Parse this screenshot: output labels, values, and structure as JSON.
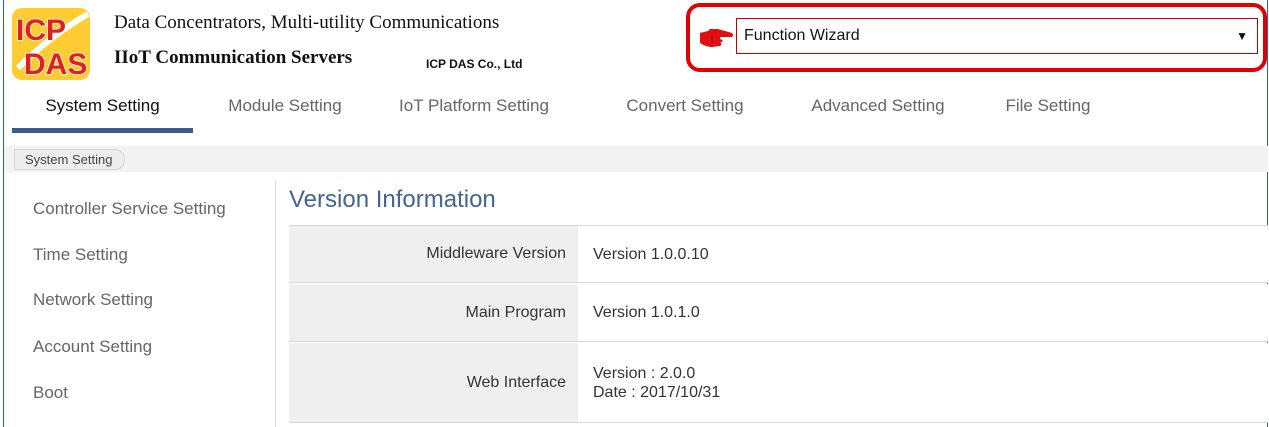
{
  "header": {
    "logo_text": "ICP DAS",
    "line1": "Data Concentrators, Multi-utility Communications",
    "line2": "IIoT Communication Servers",
    "company": "ICP DAS Co., Ltd"
  },
  "wizard": {
    "selected": "Function Wizard",
    "caret": "▼",
    "highlight_color": "#e00000"
  },
  "tabs": [
    {
      "label": "System Setting",
      "active": true
    },
    {
      "label": "Module Setting"
    },
    {
      "label": "IoT Platform Setting"
    },
    {
      "label": "Convert Setting"
    },
    {
      "label": "Advanced Setting"
    },
    {
      "label": "File Setting"
    }
  ],
  "breadcrumb": {
    "label": "System Setting"
  },
  "sidebar": {
    "items": [
      {
        "label": "Controller Service Setting"
      },
      {
        "label": "Time Setting"
      },
      {
        "label": "Network Setting"
      },
      {
        "label": "Account Setting"
      },
      {
        "label": "Boot"
      }
    ]
  },
  "main": {
    "title": "Version Information",
    "rows": [
      {
        "label": "Middleware Version",
        "value": "Version 1.0.0.10"
      },
      {
        "label": "Main Program",
        "value": "Version 1.0.1.0"
      },
      {
        "label": "Web Interface",
        "value_line1": "Version : 2.0.0",
        "value_line2": "Date : 2017/10/31"
      }
    ]
  },
  "colors": {
    "accent": "#3b5c8a",
    "title": "#44658f",
    "frame": "#2b5fb8"
  }
}
